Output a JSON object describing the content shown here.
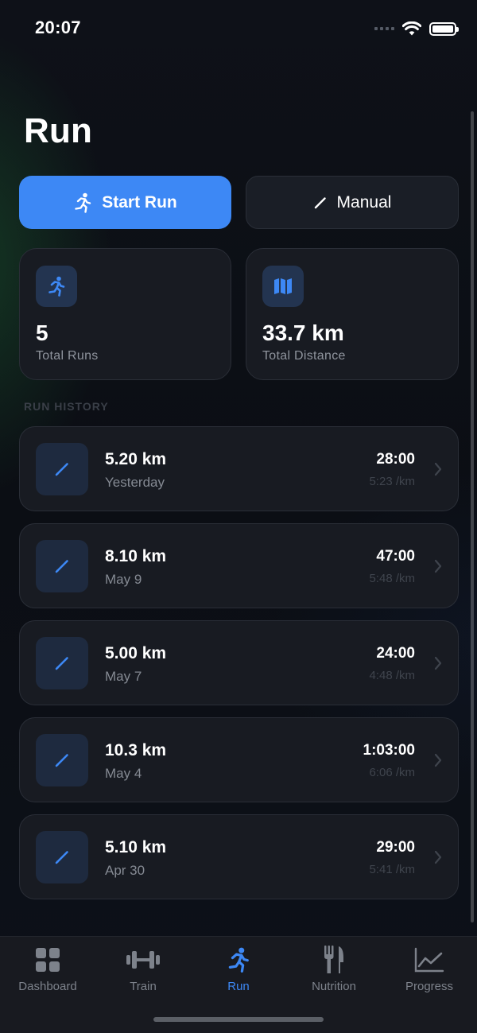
{
  "status": {
    "time": "20:07"
  },
  "header": {
    "title": "Run"
  },
  "actions": {
    "start_label": "Start Run",
    "manual_label": "Manual"
  },
  "stats": [
    {
      "value": "5",
      "label": "Total Runs",
      "icon": "running-figure-icon"
    },
    {
      "value": "33.7 km",
      "label": "Total Distance",
      "icon": "map-icon"
    }
  ],
  "history": {
    "label": "RUN HISTORY",
    "items": [
      {
        "distance": "5.20 km",
        "date": "Yesterday",
        "time": "28:00",
        "pace": "5:23 /km"
      },
      {
        "distance": "8.10 km",
        "date": "May 9",
        "time": "47:00",
        "pace": "5:48 /km"
      },
      {
        "distance": "5.00 km",
        "date": "May 7",
        "time": "24:00",
        "pace": "4:48 /km"
      },
      {
        "distance": "10.3 km",
        "date": "May 4",
        "time": "1:03:00",
        "pace": "6:06 /km"
      },
      {
        "distance": "5.10 km",
        "date": "Apr 30",
        "time": "29:00",
        "pace": "5:41 /km"
      }
    ]
  },
  "tabs": [
    {
      "label": "Dashboard",
      "icon": "dashboard-grid-icon",
      "active": false
    },
    {
      "label": "Train",
      "icon": "dumbbell-icon",
      "active": false
    },
    {
      "label": "Run",
      "icon": "running-figure-icon",
      "active": true
    },
    {
      "label": "Nutrition",
      "icon": "fork-knife-icon",
      "active": false
    },
    {
      "label": "Progress",
      "icon": "chart-line-icon",
      "active": false
    }
  ],
  "colors": {
    "accent": "#3d88f5",
    "background": "#0d1016",
    "card": "#181b22"
  }
}
